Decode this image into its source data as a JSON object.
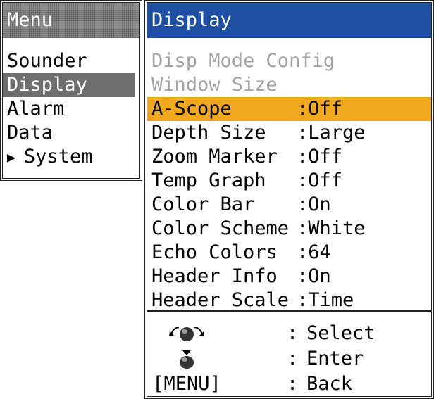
{
  "menu": {
    "title": "Menu",
    "items": [
      {
        "label": "Sounder",
        "arrow": ""
      },
      {
        "label": "Display",
        "arrow": "",
        "selected": true
      },
      {
        "label": "Alarm",
        "arrow": ""
      },
      {
        "label": "Data",
        "arrow": ""
      },
      {
        "label": "System",
        "arrow": "▶"
      }
    ]
  },
  "display": {
    "title": "Display",
    "disabled_items": [
      "Disp Mode Config",
      "Window Size"
    ],
    "settings": [
      {
        "label": "A-Scope",
        "value": ":Off"
      },
      {
        "label": "Depth Size",
        "value": ":Large"
      },
      {
        "label": "Zoom Marker",
        "value": ":Off"
      },
      {
        "label": "Temp Graph",
        "value": ":Off"
      },
      {
        "label": "Color Bar",
        "value": ":On"
      },
      {
        "label": "Color Scheme",
        "value": ":White"
      },
      {
        "label": "Echo Colors",
        "value": ":64"
      },
      {
        "label": "Header Info",
        "value": ":On"
      },
      {
        "label": "Header Scale",
        "value": ":Time"
      }
    ]
  },
  "legend": {
    "select": {
      "key_icon": "rotary-knob-icon",
      "colon": ":",
      "action": "Select"
    },
    "enter": {
      "key_icon": "push-knob-icon",
      "colon": ":",
      "action": "Enter"
    },
    "back": {
      "key": "[MENU]",
      "colon": ":",
      "action": "Back"
    }
  },
  "colors": {
    "menu_header_gray": "#8a8a8a",
    "selection_gray": "#6e6e6e",
    "display_header_blue": "#1e4fa3",
    "highlight_orange": "#f0a91e",
    "disabled_text": "#a4a4a4"
  }
}
